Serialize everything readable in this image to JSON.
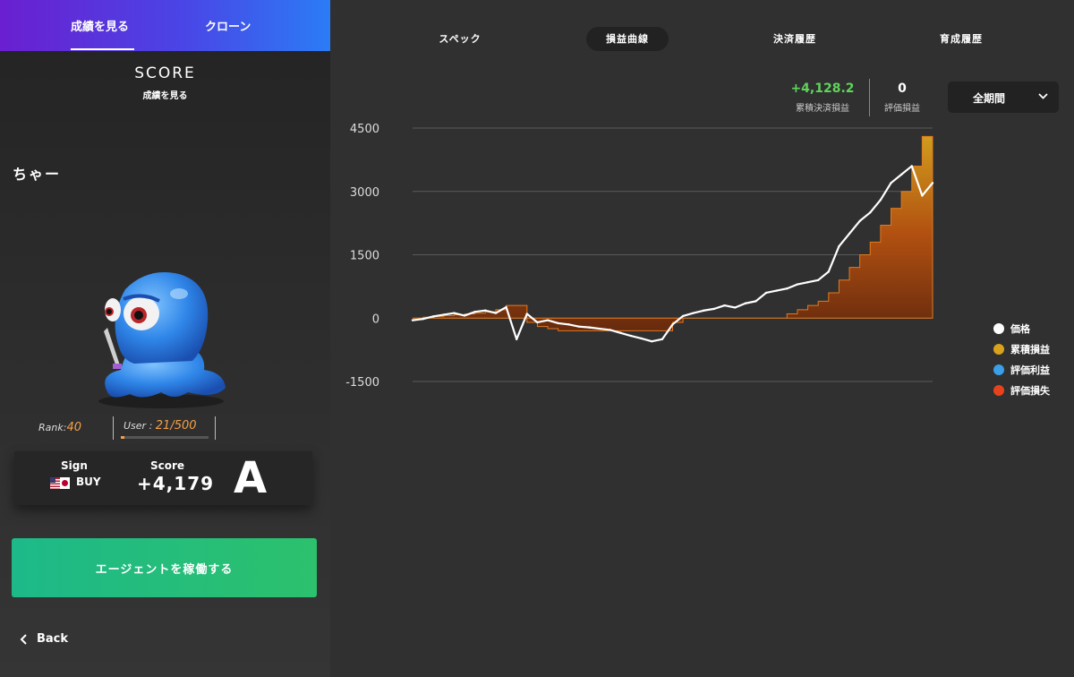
{
  "sidebar": {
    "tabs": [
      {
        "label": "成績を見る",
        "active": true
      },
      {
        "label": "クローン",
        "active": false
      }
    ],
    "score_title": "SCORE",
    "score_subtitle": "成績を見る",
    "agent_name": "ちゃー",
    "rank_label": "Rank:",
    "rank_value": "40",
    "user_label": "User : ",
    "user_value": "21/500",
    "user_progress": 0.042,
    "sign_label": "Sign",
    "sign_value": "BUY",
    "sign_icon": "us-jp-flag-icon",
    "score_label": "Score",
    "score_value": "+4,179",
    "grade": "A",
    "agent_button": "エージェントを稼働する",
    "back_label": "Back"
  },
  "nav": {
    "tabs": [
      {
        "label": "スペック",
        "active": false
      },
      {
        "label": "損益曲線",
        "active": true
      },
      {
        "label": "決済履歴",
        "active": false
      },
      {
        "label": "育成履歴",
        "active": false
      }
    ]
  },
  "stats": {
    "cumulative_value": "+4,128.2",
    "cumulative_label": "累積決済損益",
    "unrealized_value": "0",
    "unrealized_label": "評価損益"
  },
  "period": {
    "selected": "全期間"
  },
  "colors": {
    "positive": "#5fd45a",
    "price": "#ffffff",
    "cumulative": "#d9a21c",
    "profit": "#3a9ee8",
    "loss": "#e8421c",
    "accent_orange": "#f4a04a"
  },
  "chart_data": {
    "type": "area",
    "ylim": [
      -1500,
      4500
    ],
    "yticks": [
      "4500",
      "3000",
      "1500",
      "0",
      "-1500"
    ],
    "legend": [
      {
        "name": "価格",
        "color": "#ffffff"
      },
      {
        "name": "累積損益",
        "color": "#d9a21c"
      },
      {
        "name": "評価利益",
        "color": "#3a9ee8"
      },
      {
        "name": "評価損失",
        "color": "#e8421c"
      }
    ],
    "x": [
      0,
      2,
      4,
      6,
      8,
      10,
      12,
      14,
      16,
      18,
      20,
      22,
      24,
      26,
      28,
      30,
      32,
      34,
      36,
      38,
      40,
      42,
      44,
      46,
      48,
      50,
      52,
      54,
      56,
      58,
      60,
      62,
      64,
      66,
      68,
      70,
      72,
      74,
      76,
      78,
      80,
      82,
      84,
      86,
      88,
      90,
      92,
      94,
      96,
      98,
      100
    ],
    "series": [
      {
        "name": "価格",
        "values": [
          -50,
          -20,
          40,
          80,
          120,
          60,
          150,
          180,
          120,
          260,
          -500,
          100,
          -100,
          -50,
          -120,
          -150,
          -200,
          -220,
          -250,
          -280,
          -350,
          -420,
          -480,
          -550,
          -500,
          -150,
          50,
          120,
          180,
          220,
          300,
          250,
          350,
          400,
          600,
          650,
          700,
          800,
          850,
          900,
          1100,
          1700,
          2000,
          2300,
          2500,
          2800,
          3200,
          3400,
          3600,
          2900,
          3200
        ]
      },
      {
        "name": "累積損益",
        "values": [
          0,
          20,
          40,
          60,
          80,
          100,
          120,
          150,
          200,
          300,
          300,
          -100,
          -200,
          -250,
          -300,
          -300,
          -300,
          -300,
          -300,
          -300,
          -300,
          -300,
          -300,
          -300,
          -300,
          -100,
          0,
          0,
          0,
          0,
          0,
          0,
          0,
          0,
          0,
          0,
          100,
          200,
          300,
          400,
          600,
          900,
          1200,
          1500,
          1800,
          2200,
          2600,
          3000,
          3600,
          4300,
          4300
        ]
      }
    ]
  }
}
